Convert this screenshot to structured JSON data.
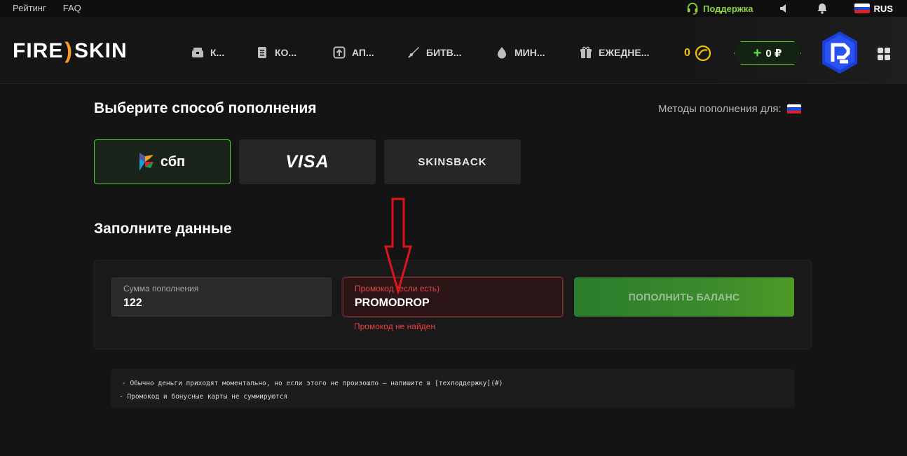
{
  "topbar": {
    "rating": "Рейтинг",
    "faq": "FAQ",
    "support": "Поддержка",
    "language": "RUS"
  },
  "logo": {
    "left": "FIRE",
    "mid": ")",
    "right": "SKIN"
  },
  "nav": [
    {
      "label": "К...",
      "icon": "case-icon"
    },
    {
      "label": "КО...",
      "icon": "contract-icon"
    },
    {
      "label": "АП...",
      "icon": "upgrade-icon"
    },
    {
      "label": "БИТВ...",
      "icon": "sword-icon"
    },
    {
      "label": "МИН...",
      "icon": "mines-icon"
    },
    {
      "label": "ЕЖЕДНЕ...",
      "icon": "gift-icon"
    }
  ],
  "coins": {
    "value": "0"
  },
  "balance": {
    "plus": "+",
    "amount": "0 ₽"
  },
  "main": {
    "title": "Выберите способ пополнения",
    "methods_for": "Методы пополнения для:",
    "methods": [
      {
        "label": "сбп",
        "active": true
      },
      {
        "label": "VISA",
        "active": false
      },
      {
        "label": "SKINSBACK",
        "active": false
      }
    ],
    "form_title": "Заполните данные",
    "amount_label": "Сумма пополнения",
    "amount_value": "122",
    "promo_label": "Промокод (если есть)",
    "promo_value": "PROMODROP",
    "promo_error": "Промокод не найден",
    "submit_label": "ПОПОЛНИТЬ БАЛАНС",
    "note1": "- Обычно деньги приходят моментально, но если этого не произошло — напишите в [техподдержку](#)",
    "note2": "- Промокод и бонусные карты не суммируются"
  },
  "colors": {
    "accent_green": "#4ecb3b",
    "error_red": "#ee3e3e",
    "coin_yellow": "#f2c200",
    "annotation_red": "#e0141c"
  }
}
